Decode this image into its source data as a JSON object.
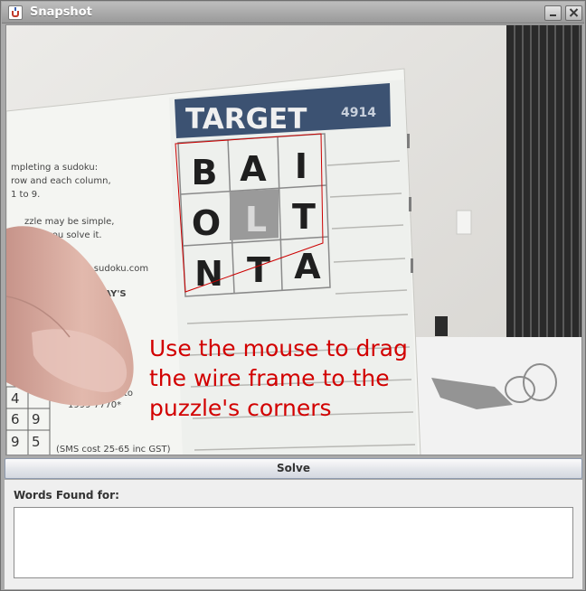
{
  "window": {
    "title": "Snapshot"
  },
  "camera": {
    "puzzle_banner": "TARGET",
    "puzzle_number": "4914",
    "grid_letters": [
      "B",
      "A",
      "I",
      "O",
      "L",
      "T",
      "N",
      "T",
      "A"
    ],
    "instruction_lines": [
      "Use the mouse to drag",
      "the wire frame to the",
      "puzzle's corners"
    ]
  },
  "solve_label": "Solve",
  "results": {
    "label": "Words Found for:",
    "value": ""
  },
  "colors": {
    "instruction_text": "#d20000",
    "wire_frame": "#cc0000",
    "titlebar": "#a9a9a9"
  }
}
